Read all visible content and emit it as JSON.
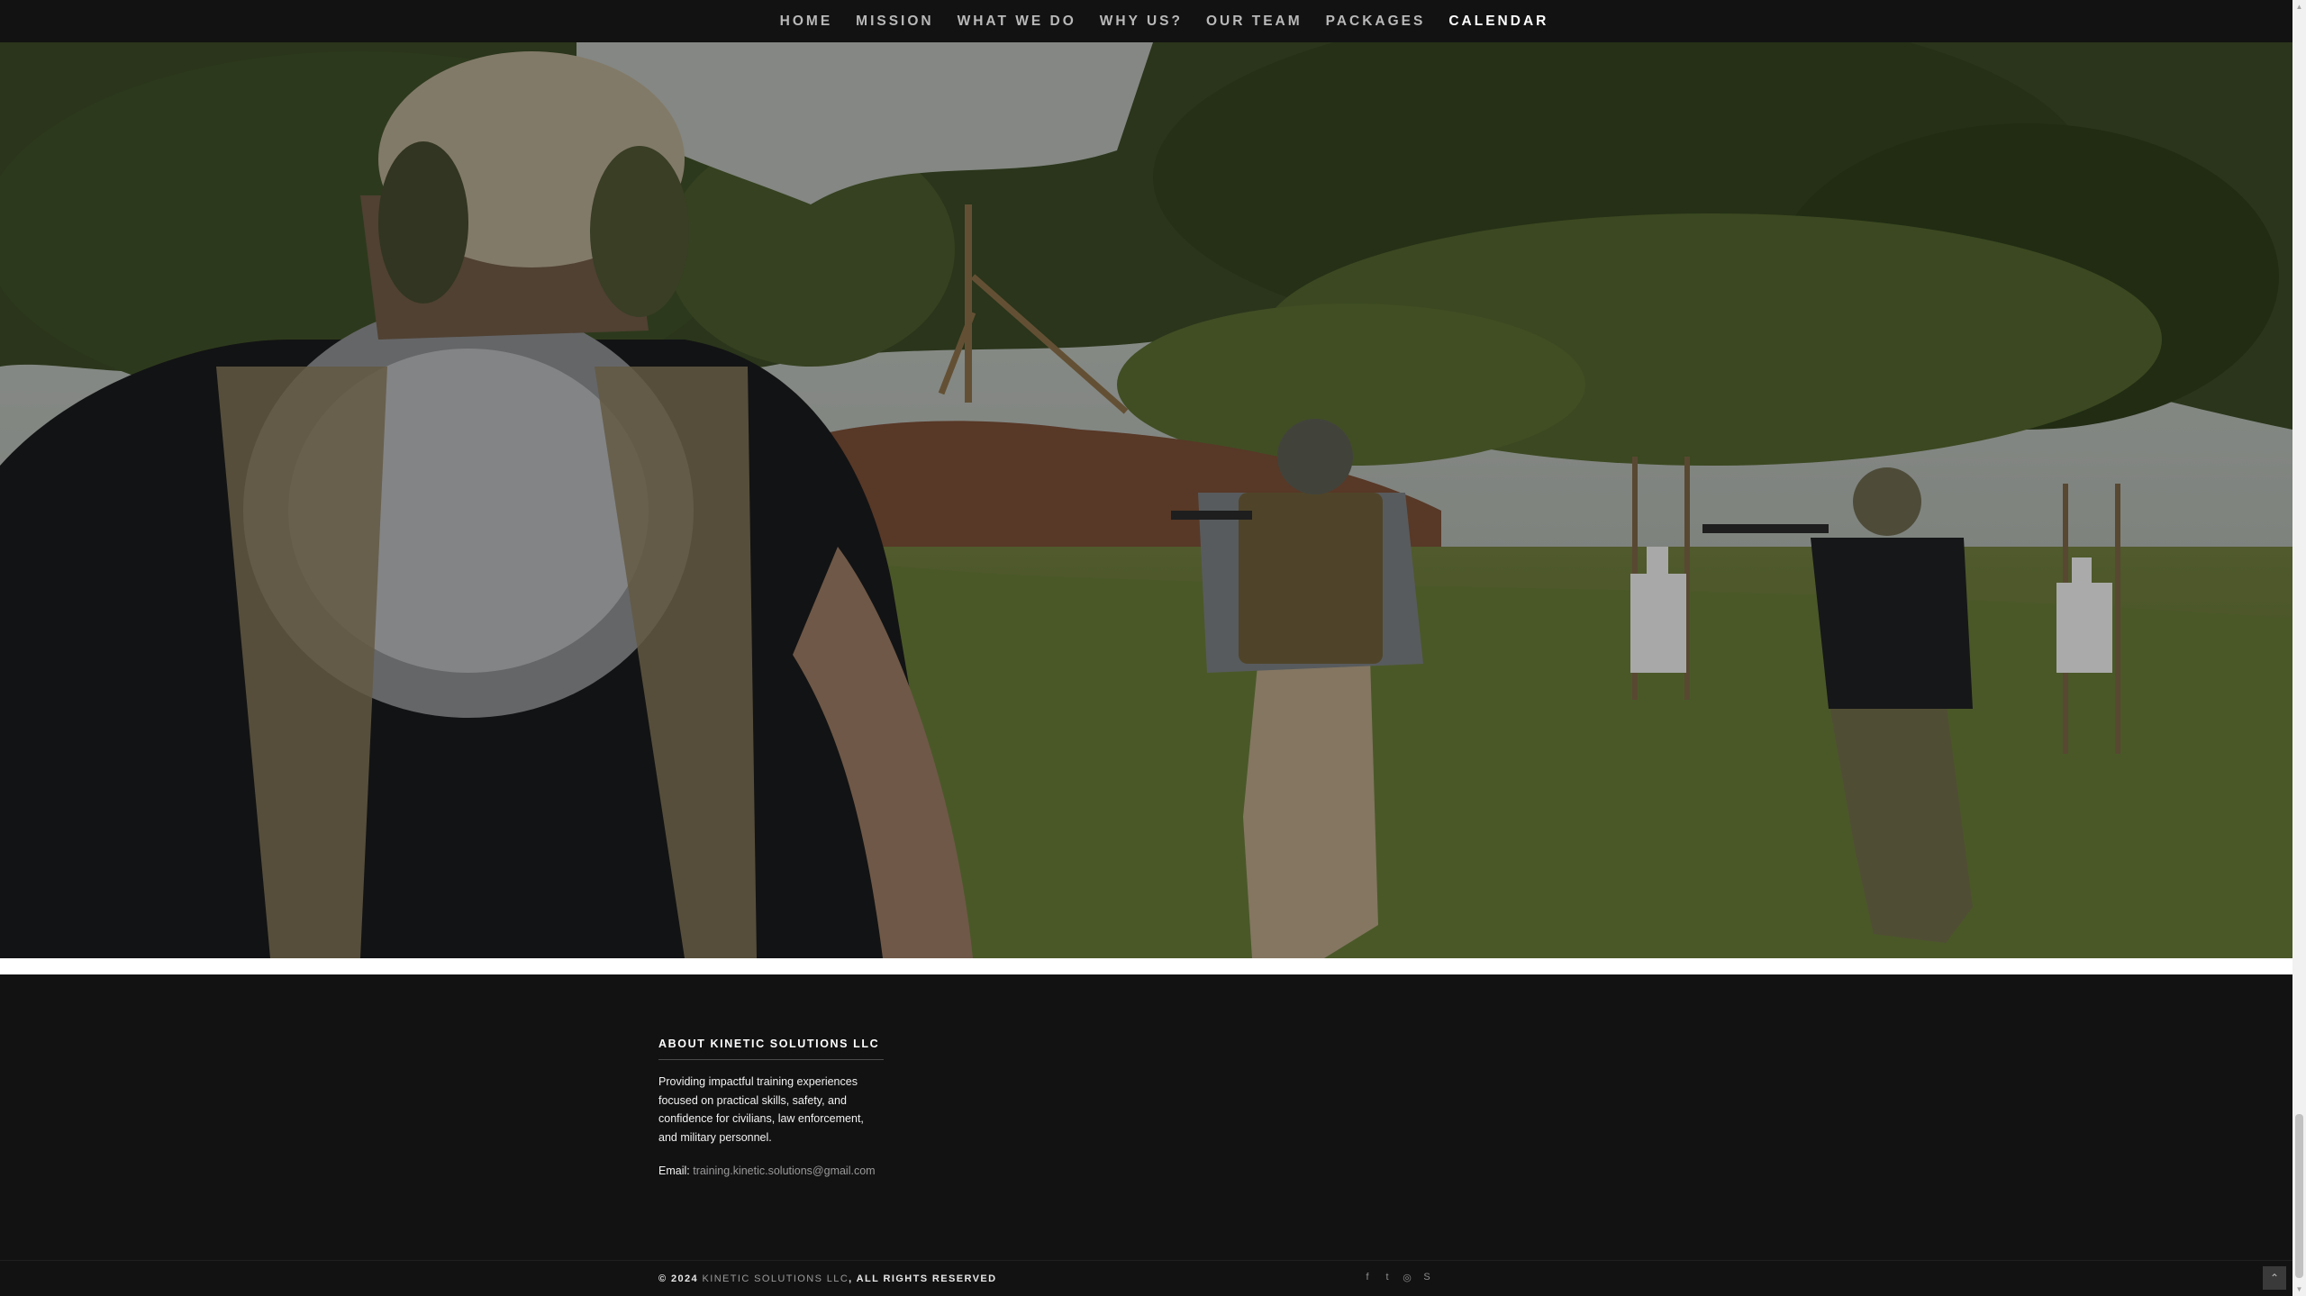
{
  "nav": {
    "items": [
      {
        "label": "HOME"
      },
      {
        "label": "MISSION"
      },
      {
        "label": "WHAT WE DO"
      },
      {
        "label": "WHY US?"
      },
      {
        "label": "OUR TEAM"
      },
      {
        "label": "PACKAGES"
      },
      {
        "label": "CALENDAR",
        "active": true
      }
    ]
  },
  "hero": {
    "image": "range training photo with three people shooting at targets"
  },
  "footer": {
    "about_title": "ABOUT KINETIC SOLUTIONS LLC",
    "about_text": "Providing impactful training experiences focused on practical skills, safety, and confidence for civilians, law enforcement, and military personnel.",
    "email_label": "Email:",
    "email": "training.kinetic.solutions@gmail.com",
    "copyright_prefix": "© 2024",
    "company": "KINETIC SOLUTIONS LLC",
    "copyright_suffix": ", ALL RIGHTS RESERVED",
    "socials": [
      "facebook-icon",
      "twitter-icon",
      "pinterest-icon",
      "skype-icon"
    ],
    "social_glyphs": [
      "f",
      "t",
      "◎",
      "S"
    ],
    "scroll_top_glyph": "⌃"
  }
}
